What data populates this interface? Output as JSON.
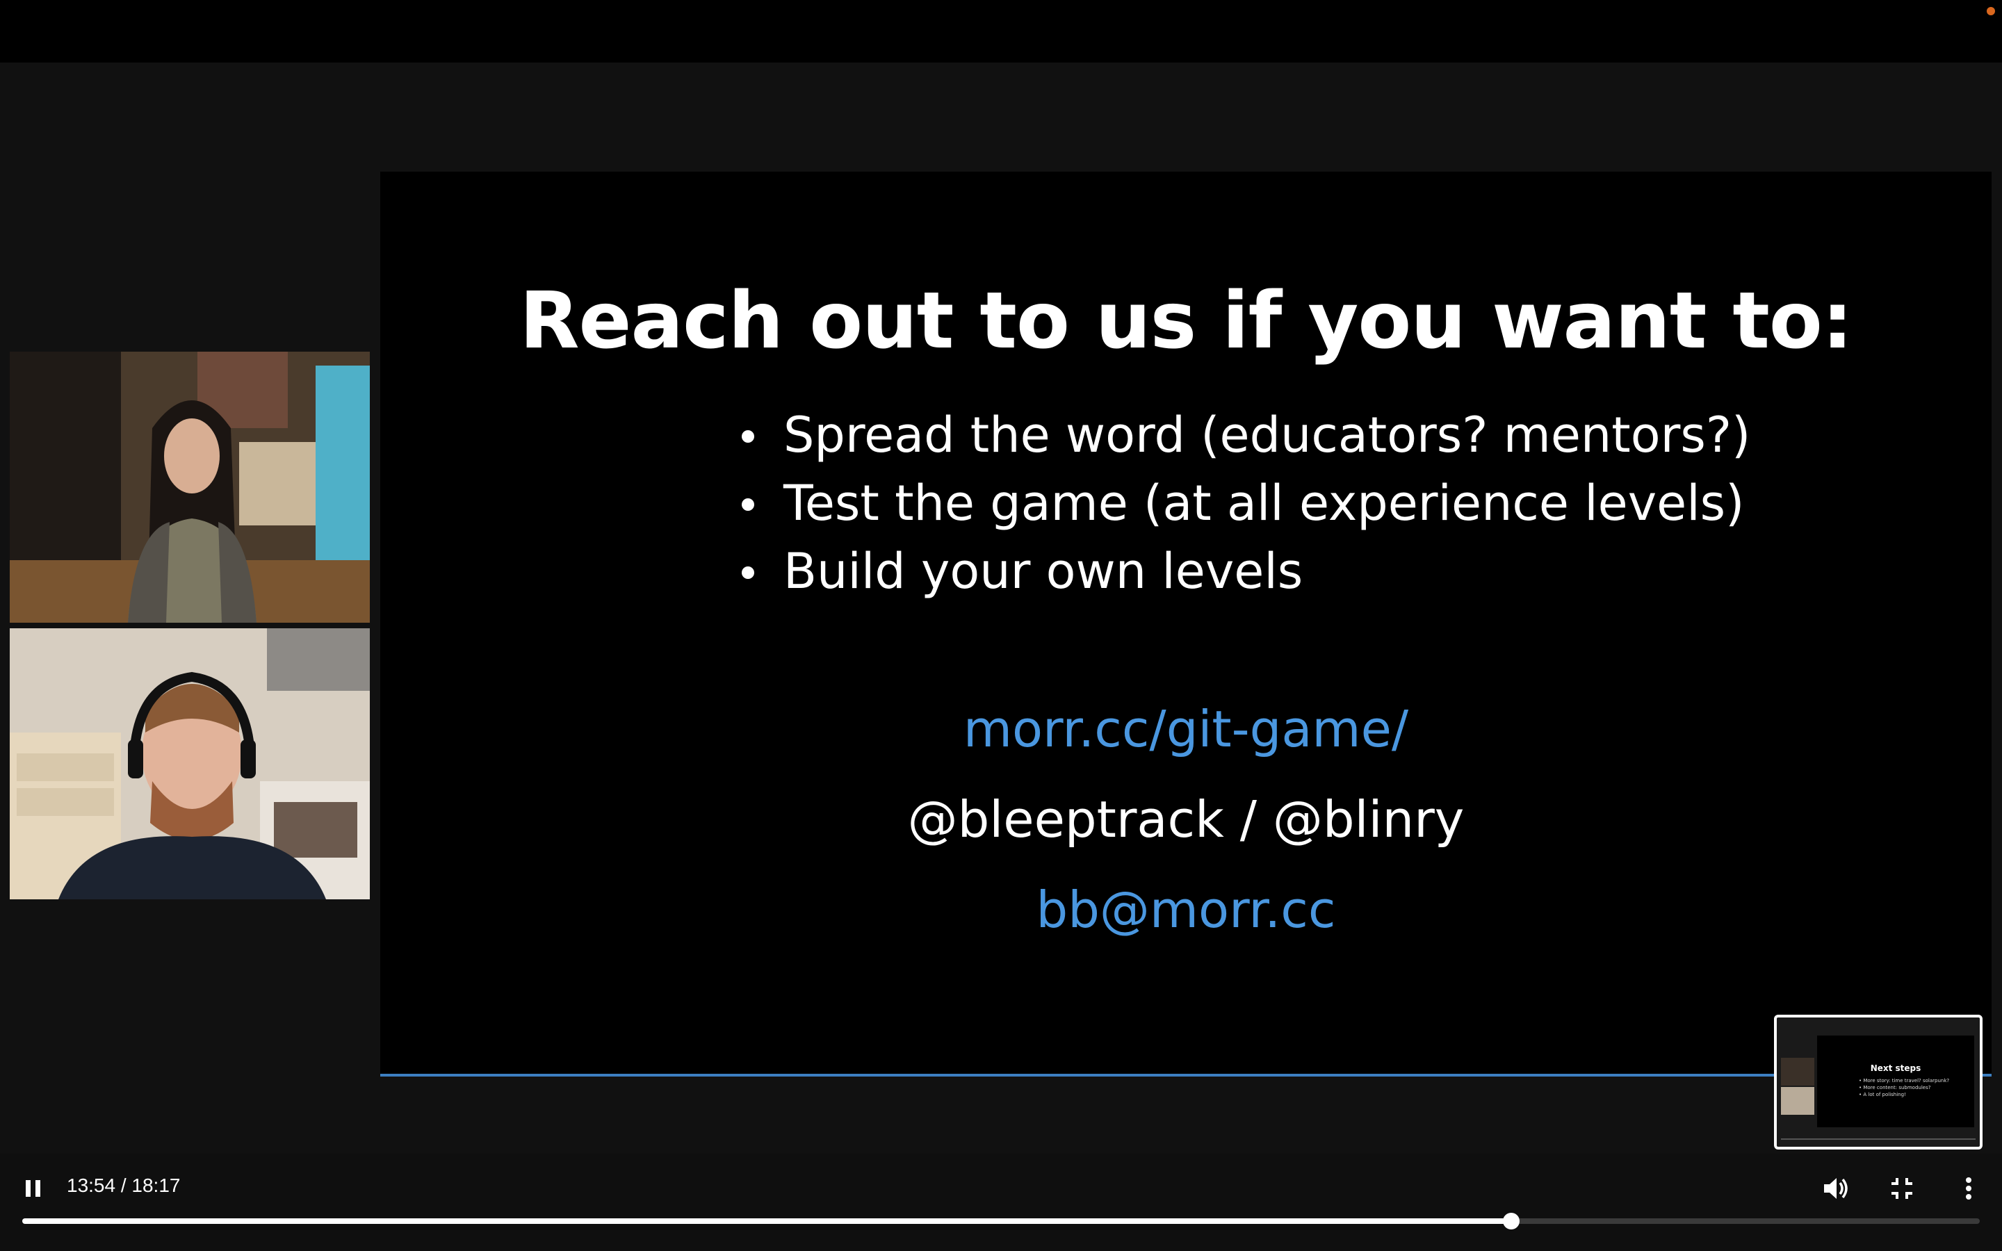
{
  "player": {
    "current_time": "13:54",
    "duration": "18:17",
    "time_display": "13:54 / 18:17",
    "progress_fraction": 0.7605,
    "state": "playing"
  },
  "slide": {
    "title": "Reach out to us if you want to:",
    "bullets": [
      "Spread the word (educators? mentors?)",
      "Test the game (at all experience levels)",
      "Build your own levels"
    ],
    "url": "morr.cc/git-game/",
    "handles": "@bleeptrack / @blinry",
    "email": "bb@morr.cc"
  },
  "preview": {
    "title": "Next steps",
    "bullets": [
      "• More story: time travel? solarpunk?",
      "• More content: submodules?",
      "• A lot of polishing!"
    ]
  },
  "colors": {
    "link": "#4a97e0",
    "slide_bg": "#000000",
    "player_bg": "#0f0f0f",
    "recording_dot": "#d9671e"
  },
  "icons": {
    "pause": "pause-icon",
    "volume": "volume-icon",
    "exit_fullscreen": "exit-fullscreen-icon",
    "more": "more-vertical-icon"
  }
}
